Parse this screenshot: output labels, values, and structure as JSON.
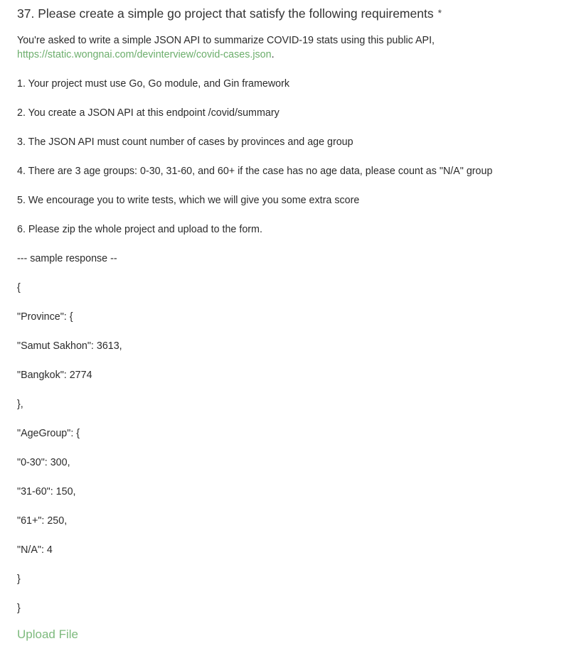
{
  "question": {
    "number_title": "37. Please create a simple go project that satisfy the following requirements",
    "required_marker": "*",
    "intro_text": "You're asked to write a simple JSON API to summarize COVID-19 stats using this public API,",
    "intro_link": "https://static.wongnai.com/devinterview/covid-cases.json",
    "intro_link_suffix": ".",
    "lines": [
      "1. Your project must use Go, Go module, and Gin framework",
      "2. You create a JSON API at this endpoint /covid/summary",
      "3. The JSON API must count number of cases by provinces and age group",
      "4. There are 3 age groups: 0-30, 31-60, and 60+ if the case has no age data, please count as \"N/A\" group",
      "5. We encourage you to write tests, which we will give you some extra score",
      "6. Please zip the whole project and upload to the form.",
      "--- sample response --",
      "{",
      "\"Province\": {",
      "\"Samut Sakhon\": 3613,",
      "\"Bangkok\": 2774",
      "},",
      "\"AgeGroup\": {",
      "\"0-30\": 300,",
      "\"31-60\": 150,",
      "\"61+\": 250,",
      "\"N/A\": 4",
      "}",
      "}"
    ],
    "upload_label": "Upload File"
  },
  "colors": {
    "link": "#6cae6c",
    "upload": "#7dba7d",
    "text": "#2b2b2b"
  }
}
